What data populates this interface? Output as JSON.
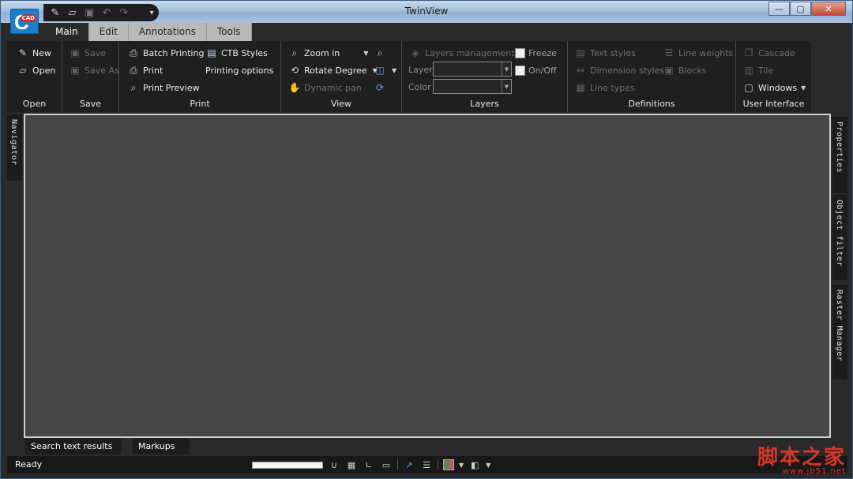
{
  "window": {
    "title": "TwinView"
  },
  "app_logo": {
    "letter": "C",
    "badge": "CAD"
  },
  "quick_access": [
    {
      "name": "new-icon",
      "glyph": "✎"
    },
    {
      "name": "open-icon",
      "glyph": "▱"
    },
    {
      "name": "save-icon",
      "glyph": "▣"
    },
    {
      "name": "undo-icon",
      "glyph": "↶"
    },
    {
      "name": "redo-icon",
      "glyph": "↷"
    },
    {
      "name": "customize-icon",
      "glyph": "▾"
    }
  ],
  "window_controls": {
    "minimize": "—",
    "maximize": "▢",
    "close": "✕"
  },
  "tabs": [
    "Main",
    "Edit",
    "Annotations",
    "Tools"
  ],
  "active_tab": "Main",
  "ribbon": {
    "open_group": {
      "label": "Open",
      "new": "New",
      "open": "Open"
    },
    "save_group": {
      "label": "Save",
      "save": "Save",
      "save_as": "Save As"
    },
    "print_group": {
      "label": "Print",
      "batch_printing": "Batch Printing",
      "print": "Print",
      "print_preview": "Print Preview",
      "ctb_styles": "CTB Styles",
      "printing_options": "Printing options"
    },
    "view_group": {
      "label": "View",
      "zoom_in": "Zoom in",
      "rotate_degree": "Rotate Degree",
      "dynamic_pan": "Dynamic pan"
    },
    "layers_group": {
      "label": "Layers",
      "layers_management": "Layers management",
      "layer": "Layer",
      "color": "Color",
      "freeze": "Freeze",
      "on_off": "On/Off"
    },
    "definitions_group": {
      "label": "Definitions",
      "text_styles": "Text styles",
      "dimension_styles": "Dimension styles",
      "line_types": "Line types",
      "line_weights": "Line weights",
      "blocks": "Blocks"
    },
    "ui_group": {
      "label": "User Interface",
      "cascade": "Cascade",
      "tile": "Tile",
      "windows": "Windows"
    }
  },
  "side_panels": {
    "left": "Navigator",
    "right": [
      "Properties",
      "Object filter",
      "Raster Manager"
    ]
  },
  "bottom_tabs": [
    "Search text results",
    "Markups"
  ],
  "status": {
    "text": "Ready"
  },
  "watermark": {
    "line1": "脚本之家",
    "line2": "www.jb51.net"
  }
}
